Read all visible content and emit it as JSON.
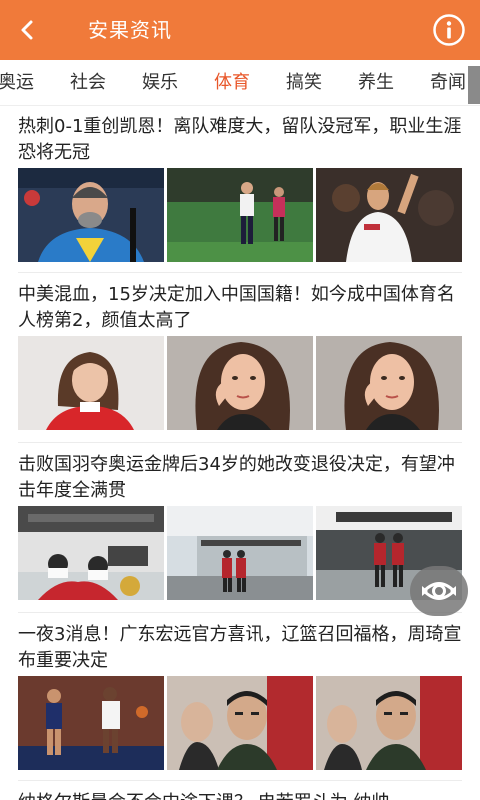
{
  "header": {
    "title": "安果资讯",
    "back_icon": "back-arrow-icon",
    "info_icon": "info-icon",
    "bg_color": "#f07a3a"
  },
  "tabs": [
    {
      "label": "奥运"
    },
    {
      "label": "社会"
    },
    {
      "label": "娱乐"
    },
    {
      "label": "体育",
      "active": true
    },
    {
      "label": "搞笑"
    },
    {
      "label": "养生"
    },
    {
      "label": "奇闻"
    }
  ],
  "accent_color": "#e8572a",
  "articles": [
    {
      "headline": "热刺0-1重创凯恩！离队难度大，留队没冠军，职业生涯恐将无冠"
    },
    {
      "headline": "中美混血，15岁决定加入中国国籍！如今成中国体育名人榜第2，颜值太高了"
    },
    {
      "headline": "击败国羽夺奥运金牌后34岁的她改变退役决定，有望冲击年度全满贯"
    },
    {
      "headline": "一夜3消息！广东宏远官方喜讯，辽篮召回福格，周琦宣布重要决定"
    },
    {
      "headline": "纳格尔斯曼会不会中途下课？ 电若罗斗为 纳帅"
    }
  ],
  "fab": {
    "icon": "eye-icon"
  }
}
